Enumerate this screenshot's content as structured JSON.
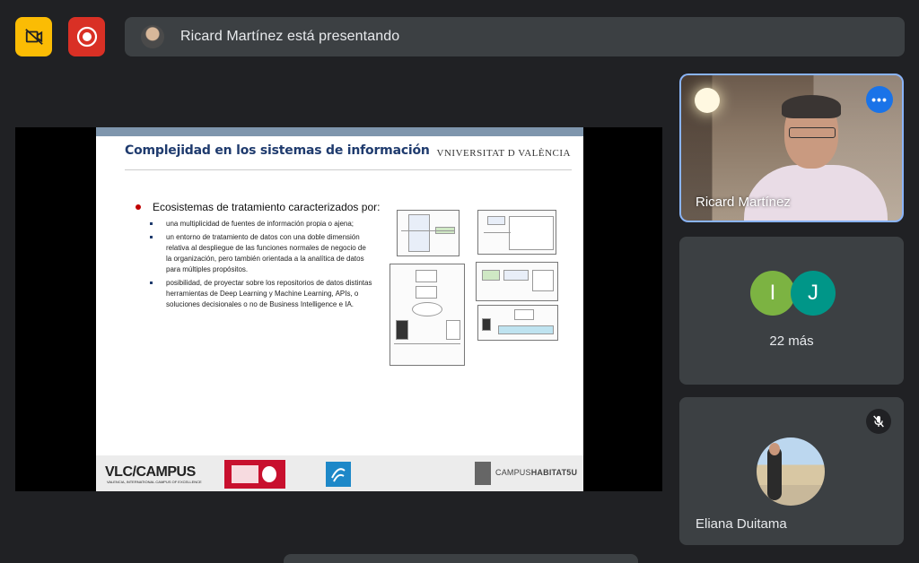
{
  "topbar": {
    "no_capture_icon": "videocam-off-icon",
    "record_icon": "record-icon",
    "banner_text": "Ricard Martínez está presentando",
    "colors": {
      "warning": "#fbbc04",
      "record": "#d93025"
    }
  },
  "slide": {
    "title": "Complejidad en los sistemas de información",
    "university": "VNIVERSITAT  D  VALÈNCIA",
    "heading": "Ecosistemas de tratamiento caracterizados por:",
    "bullets": [
      "una multiplicidad de fuentes de información propia o ajena;",
      "un entorno de tratamiento de datos con una doble dimensión relativa al despliegue de las funciones normales de negocio de la organización, pero también orientada a la analítica de datos para múltiples propósitos.",
      "posibilidad, de proyectar sobre los repositorios de datos distintas herramientas de Deep Learning y Machine Learning, APIs, o soluciones decisionales o no de Business Intelligence e IA."
    ],
    "footer": {
      "vlc": "VLC/CAMPUS",
      "vlc_sub": "VALENCIA, INTERNATIONAL CAMPUS OF EXCELLENCE",
      "campus_pre": "CAMPUS",
      "campus_bold": "HABITAT5U"
    }
  },
  "participants": {
    "presenter": {
      "name": "Ricard Martínez",
      "more_icon": "more-options-icon"
    },
    "group": {
      "avatars": [
        "I",
        "J"
      ],
      "more_label": "22 más"
    },
    "third": {
      "name": "Eliana Duitama",
      "mic_icon": "mic-off-icon"
    }
  },
  "colors": {
    "background": "#202124",
    "tile": "#3c4043",
    "accent": "#1a73e8",
    "highlight": "#8ab4f8"
  }
}
